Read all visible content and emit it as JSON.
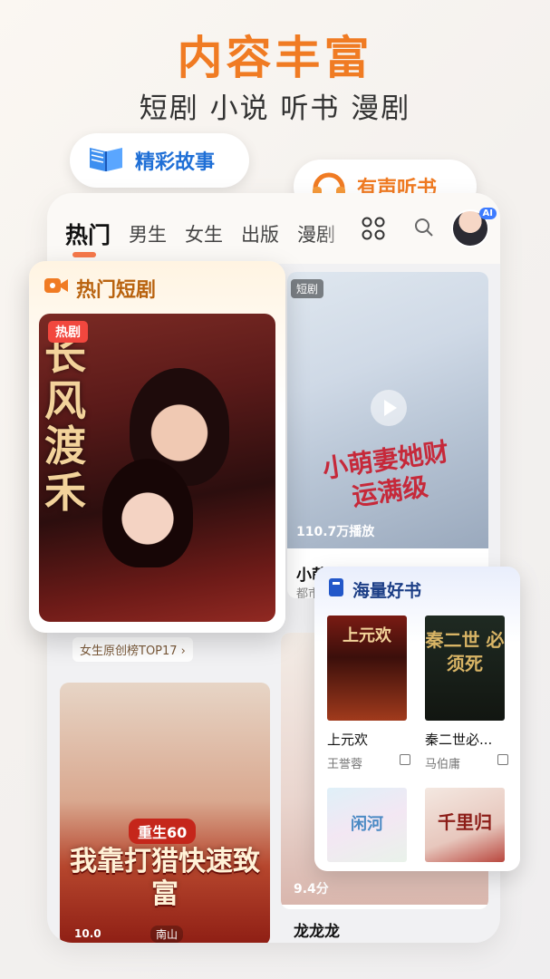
{
  "headline": "内容丰富",
  "subline": "短剧 小说 听书 漫剧",
  "pills": {
    "story": "精彩故事",
    "audio": "有声听书"
  },
  "tabs": [
    "热门",
    "男生",
    "女生",
    "出版",
    "漫剧"
  ],
  "avatar_badge": "AI",
  "hot_panel": {
    "title": "热门短剧",
    "tag": "热剧",
    "cover_art": "长风渡禾"
  },
  "short_card": {
    "tag": "短剧",
    "cover_art": "小萌妻她财运满级",
    "plays": "110.7万播放",
    "title": "小萌妻她财运满级",
    "genre": "都市"
  },
  "rank_chip": "女生原创榜TOP17 ›",
  "left_card2": {
    "rebirth": "重生60",
    "title": "我靠打猎快速致富",
    "pub": "南山",
    "num": "10.0"
  },
  "right_card2": {
    "score": "9.4分",
    "title": "龙龙龙"
  },
  "books_panel": {
    "title": "海量好书",
    "books": [
      {
        "title": "上元欢",
        "author": "王誉蓉",
        "art": "上元欢"
      },
      {
        "title": "秦二世必...",
        "author": "马伯庸",
        "art": "秦二世 必须死"
      },
      {
        "title": "",
        "author": "",
        "art": "闲河"
      },
      {
        "title": "",
        "author": "",
        "art": "千里归"
      }
    ]
  },
  "colors": {
    "accent_orange": "#f07b23",
    "story_blue": "#1f6fd6",
    "hot_red": "#f2473e"
  }
}
